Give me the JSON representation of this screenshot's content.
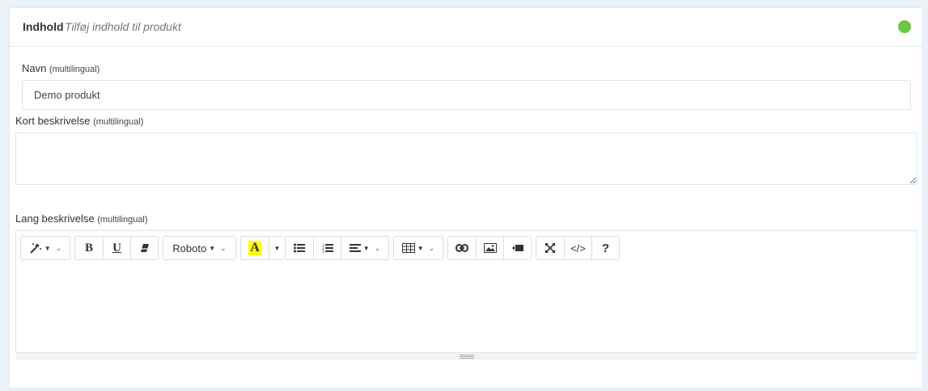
{
  "header": {
    "title": "Indhold",
    "subtitle": "Tilføj indhold til produkt",
    "status_color": "#6cc644"
  },
  "fields": {
    "name": {
      "label": "Navn",
      "note": "(multilingual)",
      "value": "Demo produkt"
    },
    "short_description": {
      "label": "Kort beskrivelse",
      "note": "(multilingual)",
      "value": ""
    },
    "long_description": {
      "label": "Lang beskrivelse",
      "note": "(multilingual)"
    }
  },
  "toolbar": {
    "font_name": "Roboto",
    "highlight_letter": "A",
    "bold": "B",
    "underline": "U",
    "code": "</>",
    "help": "?",
    "icons": [
      "magic-wand-icon",
      "bold-icon",
      "underline-icon",
      "eraser-icon",
      "font-family",
      "highlight-icon",
      "unordered-list-icon",
      "ordered-list-icon",
      "align-icon",
      "table-icon",
      "link-icon",
      "image-icon",
      "video-icon",
      "fullscreen-icon",
      "code-view-icon",
      "help-icon"
    ]
  }
}
